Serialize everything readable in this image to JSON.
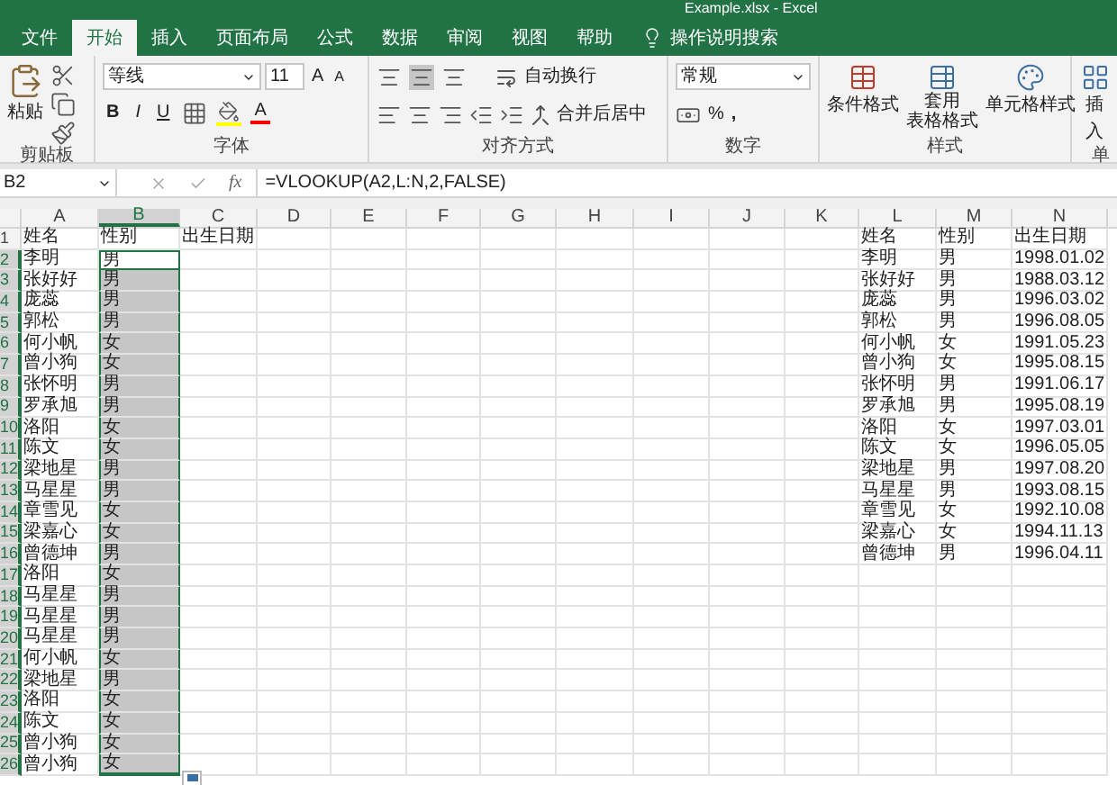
{
  "window": {
    "title": "Example.xlsx  -  Excel"
  },
  "ribbon_tabs": [
    {
      "label": "文件",
      "selected": false
    },
    {
      "label": "开始",
      "selected": true
    },
    {
      "label": "插入",
      "selected": false
    },
    {
      "label": "页面布局",
      "selected": false
    },
    {
      "label": "公式",
      "selected": false
    },
    {
      "label": "数据",
      "selected": false
    },
    {
      "label": "审阅",
      "selected": false
    },
    {
      "label": "视图",
      "selected": false
    },
    {
      "label": "帮助",
      "selected": false
    }
  ],
  "search": {
    "placeholder": "操作说明搜索"
  },
  "ribbon": {
    "clipboard": {
      "paste": "粘贴",
      "label": "剪贴板"
    },
    "font": {
      "font_name": "等线",
      "font_size": "11",
      "grow": "A",
      "shrink": "A",
      "bold": "B",
      "italic": "I",
      "underline": "U",
      "font_color": "A",
      "label": "字体"
    },
    "alignment": {
      "wrap": "自动换行",
      "merge": "合并后居中",
      "label": "对齐方式"
    },
    "number": {
      "format": "常规",
      "percent": "%",
      "comma": ",",
      "label": "数字"
    },
    "styles": {
      "conditional": "条件格式",
      "table_top": "套用",
      "table_bottom": "表格格式",
      "cell_styles": "单元格样式",
      "label": "样式"
    },
    "cells": {
      "insert": "插入",
      "label": "单"
    }
  },
  "formula_bar": {
    "name_box": "B2",
    "fx": "fx",
    "formula": "=VLOOKUP(A2,L:N,2,FALSE)"
  },
  "columns": [
    {
      "label": "A",
      "selected": false
    },
    {
      "label": "B",
      "selected": true
    },
    {
      "label": "C",
      "selected": false
    },
    {
      "label": "D",
      "selected": false
    },
    {
      "label": "E",
      "selected": false
    },
    {
      "label": "F",
      "selected": false
    },
    {
      "label": "G",
      "selected": false
    },
    {
      "label": "H",
      "selected": false
    },
    {
      "label": "I",
      "selected": false
    },
    {
      "label": "J",
      "selected": false
    },
    {
      "label": "K",
      "selected": false
    },
    {
      "label": "L",
      "selected": false
    },
    {
      "label": "M",
      "selected": false
    },
    {
      "label": "N",
      "selected": false
    }
  ],
  "rows": [
    {
      "number": "1",
      "selected": false,
      "active": false,
      "cells": {
        "A": "姓名",
        "B": "性别",
        "C": "出生日期",
        "L": "姓名",
        "M": "性别",
        "N": "出生日期"
      }
    },
    {
      "number": "2",
      "selected": true,
      "active": true,
      "cells": {
        "A": "李明",
        "B": "男",
        "L": "李明",
        "M": "男",
        "N": "1998.01.02"
      }
    },
    {
      "number": "3",
      "selected": true,
      "active": false,
      "cells": {
        "A": "张好好",
        "B": "男",
        "L": "张好好",
        "M": "男",
        "N": "1988.03.12"
      }
    },
    {
      "number": "4",
      "selected": true,
      "active": false,
      "cells": {
        "A": "庞蕊",
        "B": "男",
        "L": "庞蕊",
        "M": "男",
        "N": "1996.03.02"
      }
    },
    {
      "number": "5",
      "selected": true,
      "active": false,
      "cells": {
        "A": "郭松",
        "B": "男",
        "L": "郭松",
        "M": "男",
        "N": "1996.08.05"
      }
    },
    {
      "number": "6",
      "selected": true,
      "active": false,
      "cells": {
        "A": "何小帆",
        "B": "女",
        "L": "何小帆",
        "M": "女",
        "N": "1991.05.23"
      }
    },
    {
      "number": "7",
      "selected": true,
      "active": false,
      "cells": {
        "A": "曾小狗",
        "B": "女",
        "L": "曾小狗",
        "M": "女",
        "N": "1995.08.15"
      }
    },
    {
      "number": "8",
      "selected": true,
      "active": false,
      "cells": {
        "A": "张怀明",
        "B": "男",
        "L": "张怀明",
        "M": "男",
        "N": "1991.06.17"
      }
    },
    {
      "number": "9",
      "selected": true,
      "active": false,
      "cells": {
        "A": "罗承旭",
        "B": "男",
        "L": "罗承旭",
        "M": "男",
        "N": "1995.08.19"
      }
    },
    {
      "number": "10",
      "selected": true,
      "active": false,
      "cells": {
        "A": "洛阳",
        "B": "女",
        "L": "洛阳",
        "M": "女",
        "N": "1997.03.01"
      }
    },
    {
      "number": "11",
      "selected": true,
      "active": false,
      "cells": {
        "A": "陈文",
        "B": "女",
        "L": "陈文",
        "M": "女",
        "N": "1996.05.05"
      }
    },
    {
      "number": "12",
      "selected": true,
      "active": false,
      "cells": {
        "A": "梁地星",
        "B": "男",
        "L": "梁地星",
        "M": "男",
        "N": "1997.08.20"
      }
    },
    {
      "number": "13",
      "selected": true,
      "active": false,
      "cells": {
        "A": "马星星",
        "B": "男",
        "L": "马星星",
        "M": "男",
        "N": "1993.08.15"
      }
    },
    {
      "number": "14",
      "selected": true,
      "active": false,
      "cells": {
        "A": "章雪见",
        "B": "女",
        "L": "章雪见",
        "M": "女",
        "N": "1992.10.08"
      }
    },
    {
      "number": "15",
      "selected": true,
      "active": false,
      "cells": {
        "A": "梁嘉心",
        "B": "女",
        "L": "梁嘉心",
        "M": "女",
        "N": "1994.11.13"
      }
    },
    {
      "number": "16",
      "selected": true,
      "active": false,
      "cells": {
        "A": "曾德坤",
        "B": "男",
        "L": "曾德坤",
        "M": "男",
        "N": "1996.04.11"
      }
    },
    {
      "number": "17",
      "selected": true,
      "active": false,
      "cells": {
        "A": "洛阳",
        "B": "女"
      }
    },
    {
      "number": "18",
      "selected": true,
      "active": false,
      "cells": {
        "A": "马星星",
        "B": "男"
      }
    },
    {
      "number": "19",
      "selected": true,
      "active": false,
      "cells": {
        "A": "马星星",
        "B": "男"
      }
    },
    {
      "number": "20",
      "selected": true,
      "active": false,
      "cells": {
        "A": "马星星",
        "B": "男"
      }
    },
    {
      "number": "21",
      "selected": true,
      "active": false,
      "cells": {
        "A": "何小帆",
        "B": "女"
      }
    },
    {
      "number": "22",
      "selected": true,
      "active": false,
      "cells": {
        "A": "梁地星",
        "B": "男"
      }
    },
    {
      "number": "23",
      "selected": true,
      "active": false,
      "cells": {
        "A": "洛阳",
        "B": "女"
      }
    },
    {
      "number": "24",
      "selected": true,
      "active": false,
      "cells": {
        "A": "陈文",
        "B": "女"
      }
    },
    {
      "number": "25",
      "selected": true,
      "active": false,
      "cells": {
        "A": "曾小狗",
        "B": "女"
      }
    },
    {
      "number": "26",
      "selected": true,
      "active": false,
      "cells": {
        "A": "曾小狗",
        "B": "女"
      }
    }
  ]
}
